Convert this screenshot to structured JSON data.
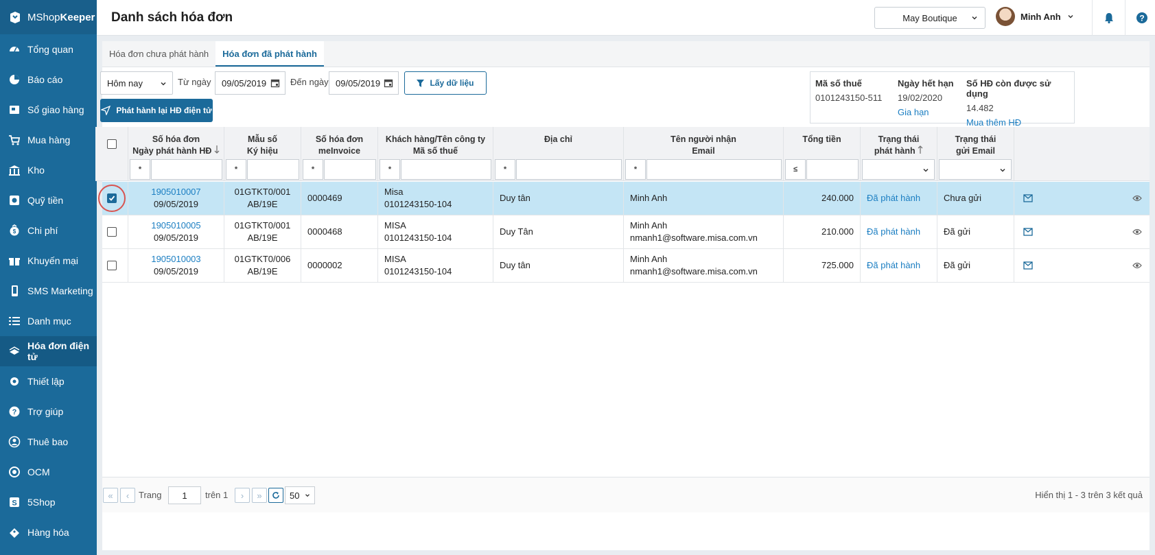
{
  "app": {
    "brand_prefix": "MShop",
    "brand_suffix": "Keeper"
  },
  "sidebar": {
    "items": [
      {
        "label": "Tổng quan",
        "icon": "dashboard-icon"
      },
      {
        "label": "Báo cáo",
        "icon": "pie-chart-icon"
      },
      {
        "label": "Sổ giao hàng",
        "icon": "delivery-icon"
      },
      {
        "label": "Mua hàng",
        "icon": "cart-icon"
      },
      {
        "label": "Kho",
        "icon": "warehouse-icon"
      },
      {
        "label": "Quỹ tiền",
        "icon": "cash-icon"
      },
      {
        "label": "Chi phí",
        "icon": "expense-icon"
      },
      {
        "label": "Khuyến mại",
        "icon": "gift-icon"
      },
      {
        "label": "SMS Marketing",
        "icon": "phone-icon"
      },
      {
        "label": "Danh mục",
        "icon": "list-icon"
      },
      {
        "label": "Hóa đơn điện tử",
        "icon": "invoice-icon",
        "active": true
      },
      {
        "label": "Thiết lập",
        "icon": "gear-icon"
      },
      {
        "label": "Trợ giúp",
        "icon": "help-icon"
      },
      {
        "label": "Thuê bao",
        "icon": "user-icon"
      },
      {
        "label": "OCM",
        "icon": "ocm-icon"
      },
      {
        "label": "5Shop",
        "icon": "5shop-icon"
      },
      {
        "label": "Hàng hóa",
        "icon": "goods-icon"
      }
    ]
  },
  "header": {
    "title": "Danh sách hóa đơn",
    "store": "May Boutique",
    "user": "Minh Anh"
  },
  "tabs": [
    {
      "label": "Hóa đơn chưa phát hành"
    },
    {
      "label": "Hóa đơn đã phát hành",
      "active": true
    }
  ],
  "filters": {
    "period": "Hôm nay",
    "from_label": "Từ ngày",
    "from_date": "09/05/2019",
    "to_label": "Đến ngày",
    "to_date": "09/05/2019",
    "fetch_label": "Lấy dữ liệu",
    "reissue_label": "Phát hành lại HĐ điện tử"
  },
  "info": {
    "tax_label": "Mã số thuế",
    "tax_value": "0101243150-511",
    "expiry_label": "Ngày hết hạn",
    "expiry_value": "19/02/2020",
    "renew_link": "Gia hạn",
    "remain_label": "Số HĐ còn được sử dụng",
    "remain_value": "14.482",
    "buy_link": "Mua thêm HĐ"
  },
  "columns": {
    "invoice_no": [
      "Số hóa đơn",
      "Ngày phát hành HĐ"
    ],
    "template": [
      "Mẫu số",
      "Ký hiệu"
    ],
    "meinvoice": [
      "Số hóa đơn",
      "meInvoice"
    ],
    "customer": [
      "Khách hàng/Tên công ty",
      "Mã số thuế"
    ],
    "address": [
      "Địa chỉ"
    ],
    "receiver": [
      "Tên người nhận",
      "Email"
    ],
    "total": [
      "Tổng tiền"
    ],
    "issue_status": [
      "Trạng thái",
      "phát hành"
    ],
    "email_status": [
      "Trạng thái",
      "gửi Email"
    ]
  },
  "filter_ops": {
    "contains": "*",
    "lte": "≤"
  },
  "rows": [
    {
      "checked": true,
      "invoice": "1905010007",
      "date": "09/05/2019",
      "template": "01GTKT0/001",
      "symbol": "AB/19E",
      "meinvoice": "0000469",
      "customer": "Misa",
      "tax": "0101243150-104",
      "address": "Duy tân",
      "receiver": "Minh Anh",
      "email": "",
      "total": "240.000",
      "issue_status": "Đã phát hành",
      "email_status": "Chưa gửi"
    },
    {
      "checked": false,
      "invoice": "1905010005",
      "date": "09/05/2019",
      "template": "01GTKT0/001",
      "symbol": "AB/19E",
      "meinvoice": "0000468",
      "customer": "MISA",
      "tax": "0101243150-104",
      "address": "Duy Tân",
      "receiver": "Minh Anh",
      "email": "nmanh1@software.misa.com.vn",
      "total": "210.000",
      "issue_status": "Đã phát hành",
      "email_status": "Đã gửi"
    },
    {
      "checked": false,
      "invoice": "1905010003",
      "date": "09/05/2019",
      "template": "01GTKT0/006",
      "symbol": "AB/19E",
      "meinvoice": "0000002",
      "customer": "MISA",
      "tax": "0101243150-104",
      "address": "Duy tân",
      "receiver": "Minh Anh",
      "email": "nmanh1@software.misa.com.vn",
      "total": "725.000",
      "issue_status": "Đã phát hành",
      "email_status": "Đã gửi"
    }
  ],
  "pager": {
    "page_label": "Trang",
    "page": "1",
    "of_label": "trên 1",
    "page_size": "50",
    "summary": "Hiển thị 1 - 3 trên 3 kết quả"
  },
  "colors": {
    "primary": "#1b6a9a",
    "link": "#1b7ec2",
    "selected_row": "#c4e5f5",
    "highlight_ring": "#d9534f"
  }
}
